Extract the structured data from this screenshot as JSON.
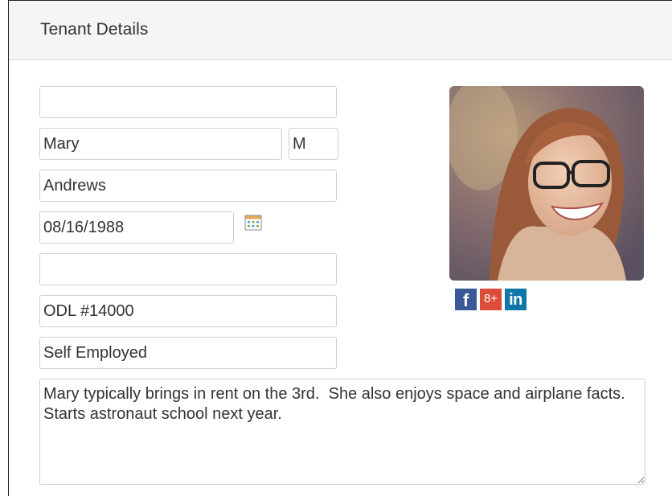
{
  "panel": {
    "title": "Tenant Details"
  },
  "form": {
    "field_1": "",
    "first_name": "Mary",
    "middle_initial": "M",
    "last_name": "Andrews",
    "birth_date": "08/16/1988",
    "field_5": "",
    "license": "ODL #14000",
    "employment": "Self Employed",
    "notes": "Mary typically brings in rent on the 3rd.  She also enjoys space and airplane facts.  Starts astronaut school next year."
  },
  "icons": {
    "calendar": "calendar-icon",
    "facebook": "facebook-icon",
    "google_plus": "google-plus-icon",
    "linkedin": "linkedin-icon"
  },
  "social": {
    "facebook_glyph": "f",
    "google_plus_glyph": "8+",
    "linkedin_glyph": "in"
  },
  "colors": {
    "facebook": "#3b5998",
    "google_plus": "#dd4b39",
    "linkedin": "#0e76a8",
    "header_bg": "#f5f5f5"
  }
}
